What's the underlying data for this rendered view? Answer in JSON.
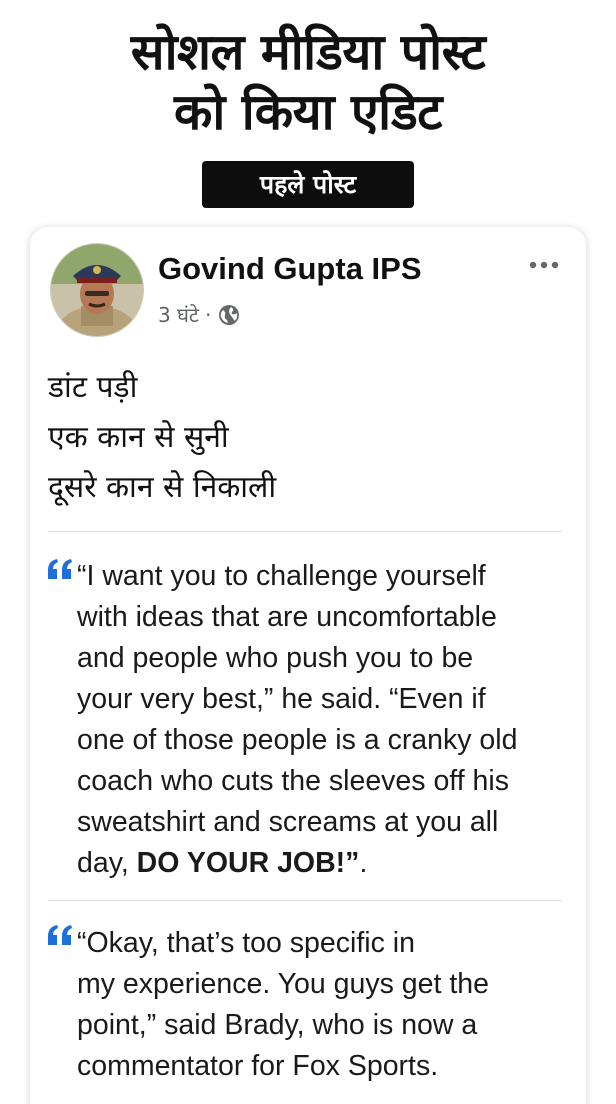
{
  "header": {
    "headline_line1": "सोशल मीडिया पोस्ट",
    "headline_line2": "को किया एडिट",
    "badge": "पहले पोस्ट"
  },
  "post": {
    "author": "Govind Gupta IPS",
    "time": "3 घंटे",
    "separator": "·",
    "privacy_icon": "globe-icon",
    "more_icon": "more-options-icon",
    "lines": [
      "डांट पड़ी",
      "एक कान से सुनी",
      "दूसरे कान से निकाली"
    ]
  },
  "quotes": [
    {
      "icon": "quote-mark-icon",
      "lines": [
        "“I want you to challenge yourself",
        "with ideas that are uncomfortable",
        "and people who push you to be",
        "your very best,” he said. “Even if",
        "one of those people is a cranky old",
        "coach who cuts the sleeves off his",
        "sweatshirt and screams at you all"
      ],
      "last_line_prefix": "day, ",
      "last_line_bold": "DO YOUR JOB!”",
      "last_line_suffix": "."
    },
    {
      "icon": "quote-mark-icon",
      "lines": [
        "“Okay, that’s too specific in",
        "my experience. You guys get the",
        "point,” said Brady, who is now a",
        "commentator for Fox Sports."
      ]
    }
  ],
  "colors": {
    "quote_mark": "#1e6fd9",
    "badge_bg": "#0d0d0d",
    "meta_text": "#5f6368"
  }
}
